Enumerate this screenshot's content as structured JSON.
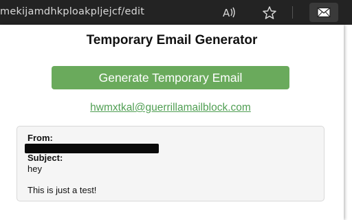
{
  "browser": {
    "url": "mekijamdhkploakpljejcf/edit",
    "read_aloud_glyph": "A))",
    "star_glyph": "☆"
  },
  "popup": {
    "title": "Temporary Email Generator",
    "generate_label": "Generate Temporary Email",
    "email": "hwmxtkal@guerrillamailblock.com",
    "message": {
      "from_label": "From:",
      "subject_label": "Subject:",
      "subject": "hey",
      "body": "This is just a test!"
    }
  },
  "colors": {
    "accent": "#6aaa5c",
    "link": "#4f9e52",
    "toolbar": "#232323"
  }
}
